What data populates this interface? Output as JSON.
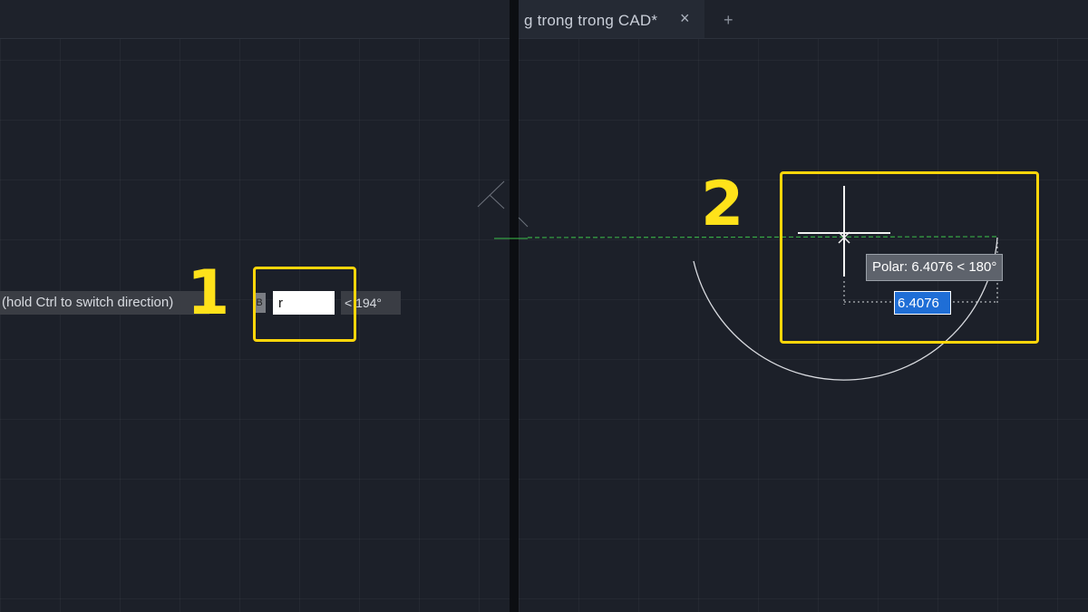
{
  "left_panel": {
    "step_number": "1",
    "prompt_text": "(hold Ctrl to switch direction)",
    "small_marker": "B",
    "length_input_value": "r",
    "angle_value": "< 194°"
  },
  "right_panel": {
    "tab": {
      "title": "g trong trong CAD*",
      "close_icon": "×",
      "add_icon": "+"
    },
    "step_number": "2",
    "polar_tooltip": "Polar: 6.4076 < 180°",
    "dimension_input_value": "6.4076"
  },
  "colors": {
    "highlight": "#ffd60a",
    "background": "#1c2029",
    "polar_track": "#3cc04a",
    "input_selected": "#1f6ed6"
  }
}
